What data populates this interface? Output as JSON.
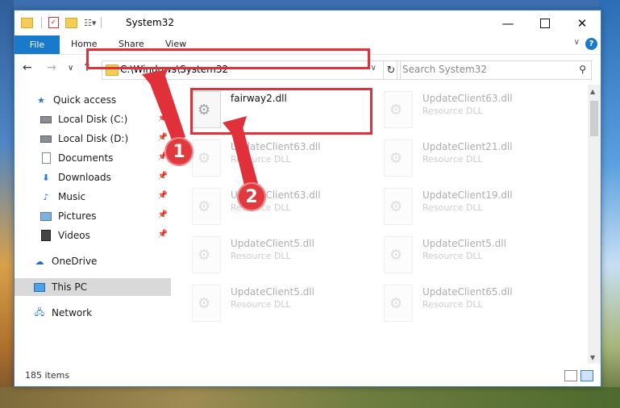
{
  "window": {
    "title": "System32"
  },
  "ribbon": {
    "tabs": [
      "File",
      "Home",
      "Share",
      "View"
    ]
  },
  "address": {
    "path": "C:\\Windows\\System32"
  },
  "search": {
    "placeholder": "Search System32"
  },
  "sidebar": {
    "items": [
      {
        "label": "Quick access",
        "icon": "star-icon"
      },
      {
        "label": "Local Disk (C:)",
        "icon": "drive-icon",
        "pinned": true
      },
      {
        "label": "Local Disk (D:)",
        "icon": "drive-icon",
        "pinned": true
      },
      {
        "label": "Documents",
        "icon": "documents-icon",
        "pinned": true
      },
      {
        "label": "Downloads",
        "icon": "download-icon",
        "pinned": true
      },
      {
        "label": "Music",
        "icon": "music-icon",
        "pinned": true
      },
      {
        "label": "Pictures",
        "icon": "pictures-icon",
        "pinned": true
      },
      {
        "label": "Videos",
        "icon": "videos-icon",
        "pinned": true
      },
      {
        "label": "OneDrive",
        "icon": "cloud-icon"
      },
      {
        "label": "This PC",
        "icon": "computer-icon",
        "selected": true
      },
      {
        "label": "Network",
        "icon": "network-icon"
      }
    ]
  },
  "files": [
    {
      "name": "fairway2.dll",
      "type": ""
    },
    {
      "name": "UpdateClient63.dll",
      "type": "Resource DLL"
    },
    {
      "name": "UpdateClient63.dll",
      "type": "Resource DLL"
    },
    {
      "name": "UpdateClient21.dll",
      "type": "Resource DLL"
    },
    {
      "name": "UpdateClient63.dll",
      "type": "Resource DLL"
    },
    {
      "name": "UpdateClient19.dll",
      "type": "Resource DLL"
    },
    {
      "name": "UpdateClient5.dll",
      "type": "Resource DLL"
    },
    {
      "name": "UpdateClient5.dll",
      "type": "Resource DLL"
    },
    {
      "name": "UpdateClient5.dll",
      "type": "Resource DLL"
    },
    {
      "name": "UpdateClient65.dll",
      "type": "Resource DLL"
    }
  ],
  "status": {
    "items": "185 items"
  },
  "callouts": [
    "1",
    "2"
  ],
  "colors": {
    "accent": "#1979ca",
    "annotation": "#e0303a"
  }
}
